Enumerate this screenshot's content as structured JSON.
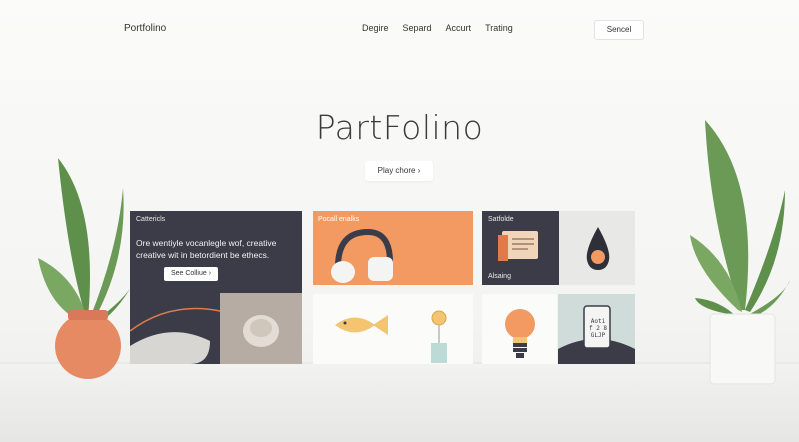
{
  "nav": {
    "logo": "Portfolino",
    "links": [
      "Degire",
      "Separd",
      "Accurt",
      "Trating"
    ],
    "button": "Sencel"
  },
  "hero": {
    "title": "PartFolino",
    "button": "Play chore",
    "button_icon": "chevron-right-icon"
  },
  "tiles": {
    "t1": {
      "label": "Cattericls",
      "text": "Ore wentiyle vocanlegle wof, creative creative wit in betordient be ethecs.",
      "button": "See Colliue",
      "button_icon": "chevron-right-icon"
    },
    "t2": {
      "label": "Pocall enalks"
    },
    "t3": {
      "label": "Satfolde",
      "label2": "Alsaing"
    },
    "t6": {
      "lines": [
        "Aoti",
        "f 2 8",
        "GLJP"
      ]
    }
  },
  "colors": {
    "accent": "#f39a63",
    "dark": "#3b3c48",
    "plant": "#6a9a55",
    "pot": "#e58a63"
  }
}
